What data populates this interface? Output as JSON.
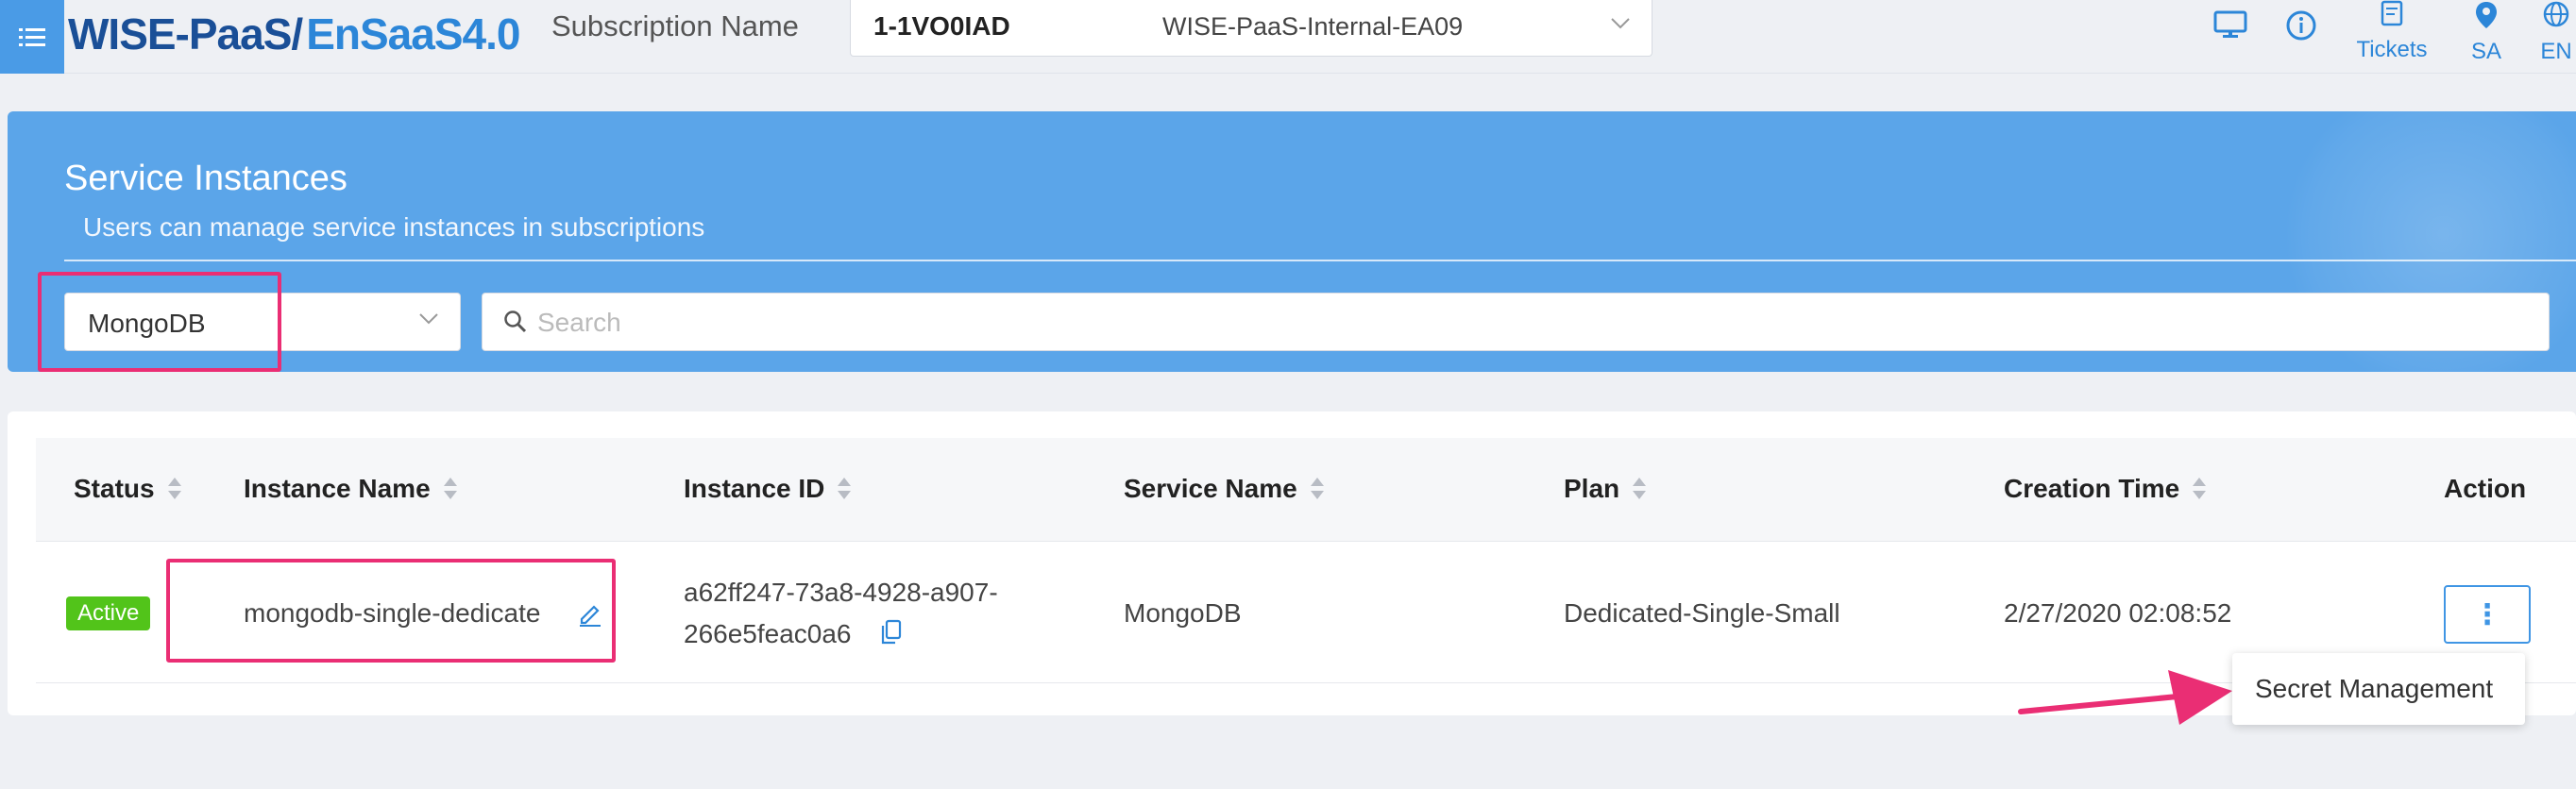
{
  "header": {
    "logo_part1": "WISE-PaaS/",
    "logo_part2": "EnSaaS4.0",
    "subscription_label": "Subscription Name",
    "subscription_id": "1-1VO0IAD",
    "subscription_name": "WISE-PaaS-Internal-EA09",
    "icons": [
      {
        "name": "monitor-icon",
        "label": ""
      },
      {
        "name": "info-icon",
        "label": ""
      },
      {
        "name": "tickets-icon",
        "label": "Tickets"
      },
      {
        "name": "location-icon",
        "label": "SA"
      },
      {
        "name": "globe-icon",
        "label": "EN"
      }
    ],
    "colors": {
      "brand_dark": "#1a4f97",
      "brand_light": "#2c86d8",
      "accent": "#4a9be6"
    }
  },
  "banner": {
    "title": "Service Instances",
    "subtitle": "Users can manage service instances in subscriptions",
    "service_filter": "MongoDB",
    "search_placeholder": "Search",
    "color": "#5ba5e9"
  },
  "table": {
    "columns": [
      "Status",
      "Instance Name",
      "Instance ID",
      "Service Name",
      "Plan",
      "Creation Time",
      "Action"
    ],
    "rows": [
      {
        "status": "Active",
        "instance_name": "mongodb-single-dedicate",
        "instance_id_line1": "a62ff247-73a8-4928-a907-",
        "instance_id_line2": "266e5feac0a6",
        "service_name": "MongoDB",
        "plan": "Dedicated-Single-Small",
        "creation_time": "2/27/2020 02:08:52",
        "action_label": "⋮"
      }
    ],
    "status_color": "#52c41a"
  },
  "action_menu": {
    "items": [
      "Secret Management"
    ]
  },
  "annotations": {
    "highlight_color": "#ea2e74"
  }
}
